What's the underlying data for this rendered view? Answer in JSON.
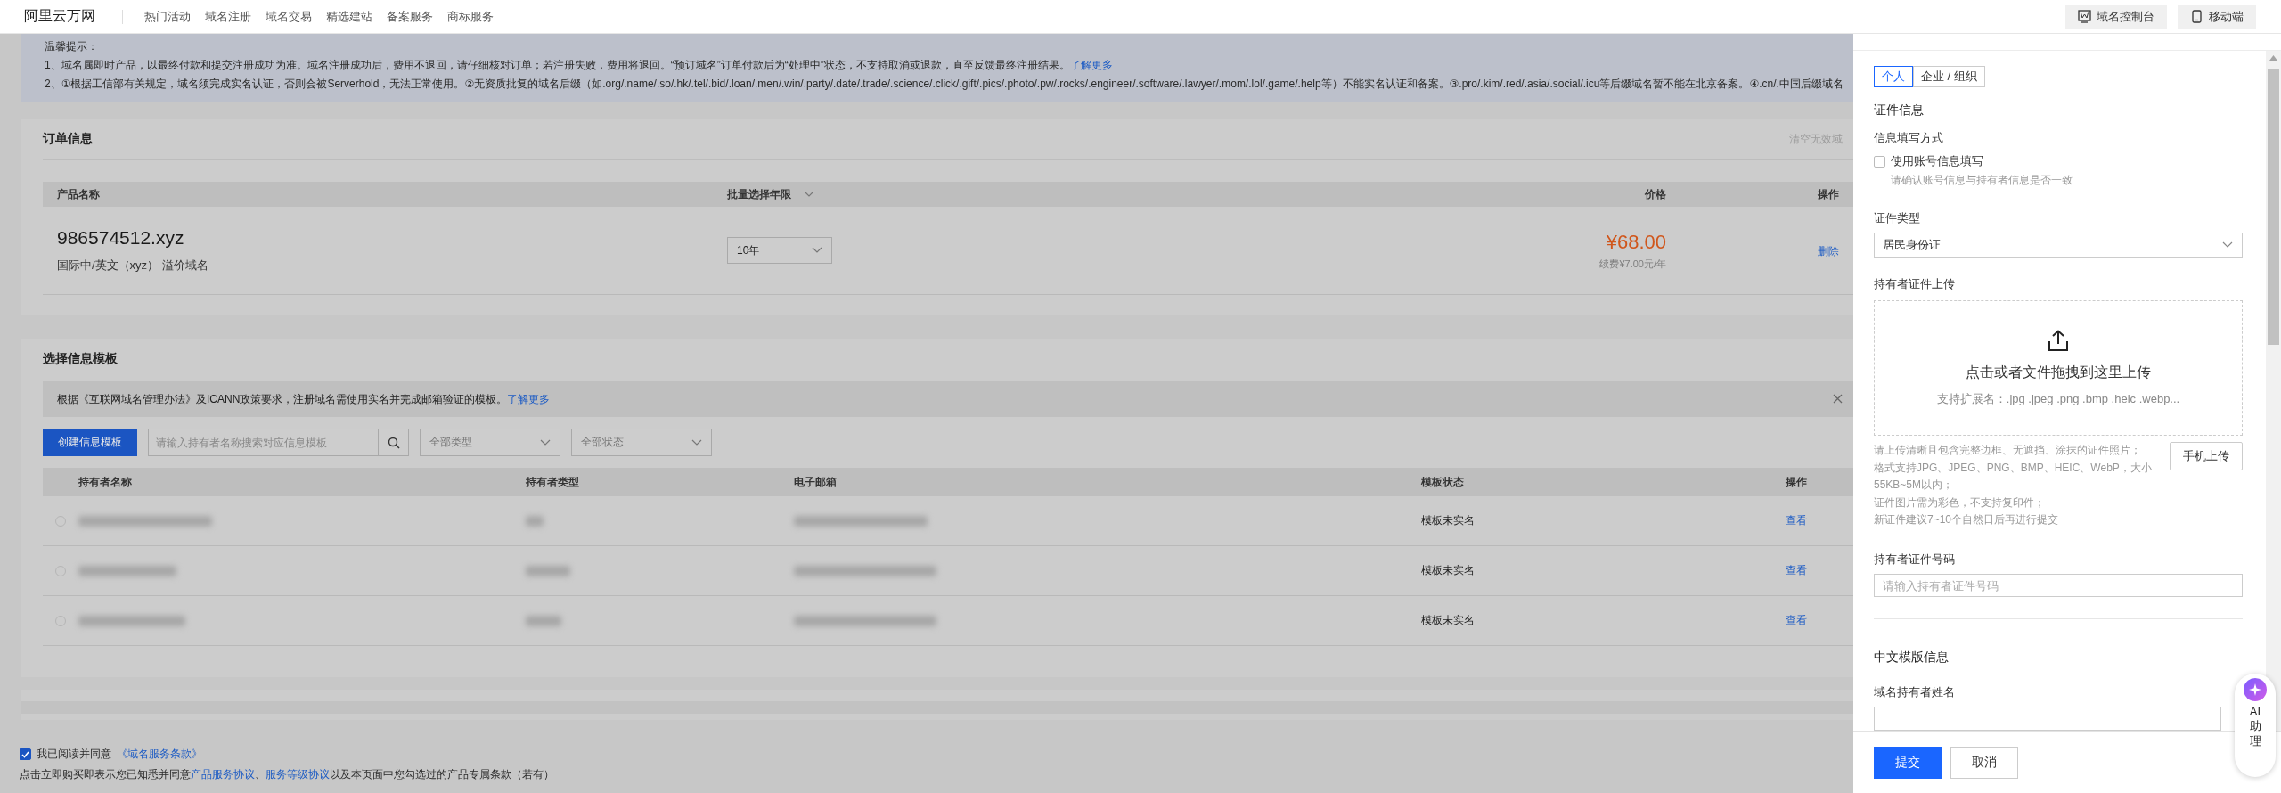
{
  "nav": {
    "logo": "阿里云万网",
    "items": [
      "热门活动",
      "域名注册",
      "域名交易",
      "精选建站",
      "备案服务",
      "商标服务"
    ],
    "actions": [
      "域名控制台",
      "移动端"
    ]
  },
  "notice": {
    "title": "温馨提示：",
    "lines": [
      {
        "text": "1、域名属即时产品，以最终付款和提交注册成功为准。域名注册成功后，费用不退回，请仔细核对订单；若注册失败，费用将退回。“预订域名”订单付款后为“处理中”状态，不支持取消或退款，直至反馈最终注册结果。",
        "link": "了解更多"
      },
      {
        "text": "2、①根据工信部有关规定，域名须完成实名认证，否则会被Serverhold，无法正常使用。②无资质批复的域名后缀（如.org/.name/.so/.hk/.tel/.bid/.loan/.men/.win/.party/.date/.trade/.science/.click/.gift/.pics/.photo/.pw/.rocks/.engineer/.software/.lawyer/.mom/.lol/.game/.help等）不能实名认证和备案。③.pro/.kim/.red/.asia/.social/.icu等后缀域名暂不能在北京备案。④.cn/.中国后缀域名"
      }
    ]
  },
  "order": {
    "title": "订单信息",
    "clear_link": "清空无效域",
    "columns": [
      "产品名称",
      "批量选择年限",
      "价格",
      "操作"
    ],
    "rows": [
      {
        "domain": "986574512.xyz",
        "description": "国际中/英文（xyz） 溢价域名",
        "term": "10年",
        "price": "¥68.00",
        "renewal": "续费¥7.00元/年",
        "action": "删除"
      }
    ]
  },
  "templates": {
    "title": "选择信息模板",
    "info": {
      "text": "根据《互联网域名管理办法》及ICANN政策要求，注册域名需使用实名并完成邮箱验证的模板。",
      "link": "了解更多"
    },
    "create_button": "创建信息模板",
    "search": {
      "placeholder": "请输入持有者名称搜索对应信息模板"
    },
    "filters": [
      "全部类型",
      "全部状态"
    ],
    "columns": [
      "持有者名称",
      "持有者类型",
      "电子邮箱",
      "模板状态",
      "操作"
    ],
    "rows": [
      {
        "selected": false,
        "status": "模板未实名",
        "action": "查看"
      },
      {
        "selected": false,
        "status": "模板未实名",
        "action": "查看"
      },
      {
        "selected": false,
        "status": "模板未实名",
        "action": "查看"
      }
    ]
  },
  "agreement": {
    "checked": true,
    "label": "我已阅读并同意",
    "terms_link": "《域名服务条款》",
    "notice": {
      "prefix": "点击立即购买即表示您已知悉并同意",
      "links": [
        "产品服务协议",
        "服务等级协议"
      ],
      "separator": "、",
      "suffix": "以及本页面中您勾选过的产品专属条款（若有）"
    }
  },
  "panel": {
    "tabs": [
      {
        "label": "个人",
        "selected": true
      },
      {
        "label": "企业 / 组织",
        "selected": false
      }
    ],
    "section_title": "证件信息",
    "fill_method_label": "信息填写方式",
    "use_account": {
      "label": "使用账号信息填写",
      "checked": false,
      "hint": "请确认账号信息与持有者信息是否一致"
    },
    "id_type": {
      "label": "证件类型",
      "value": "居民身份证"
    },
    "upload": {
      "label": "持有者证件上传",
      "title": "点击或者文件拖拽到这里上传",
      "hint": "支持扩展名：.jpg .jpeg .png .bmp .heic .webp...",
      "notes": [
        "请上传清晰且包含完整边框、无遮挡、涂抹的证件照片；",
        "格式支持JPG、JPEG、PNG、BMP、HEIC、WebP，大小55KB~5M以内；",
        "证件图片需为彩色，不支持复印件；",
        "新证件建议7~10个自然日后再进行提交"
      ],
      "mobile_button": "手机上传"
    },
    "id_number": {
      "label": "持有者证件号码",
      "placeholder": "请输入持有者证件号码"
    },
    "chinese_section_title": "中文模版信息",
    "holder_name": {
      "label": "域名持有者姓名"
    },
    "buttons": [
      "提交",
      "取消"
    ]
  },
  "assistant": {
    "label": "AI 助理"
  }
}
